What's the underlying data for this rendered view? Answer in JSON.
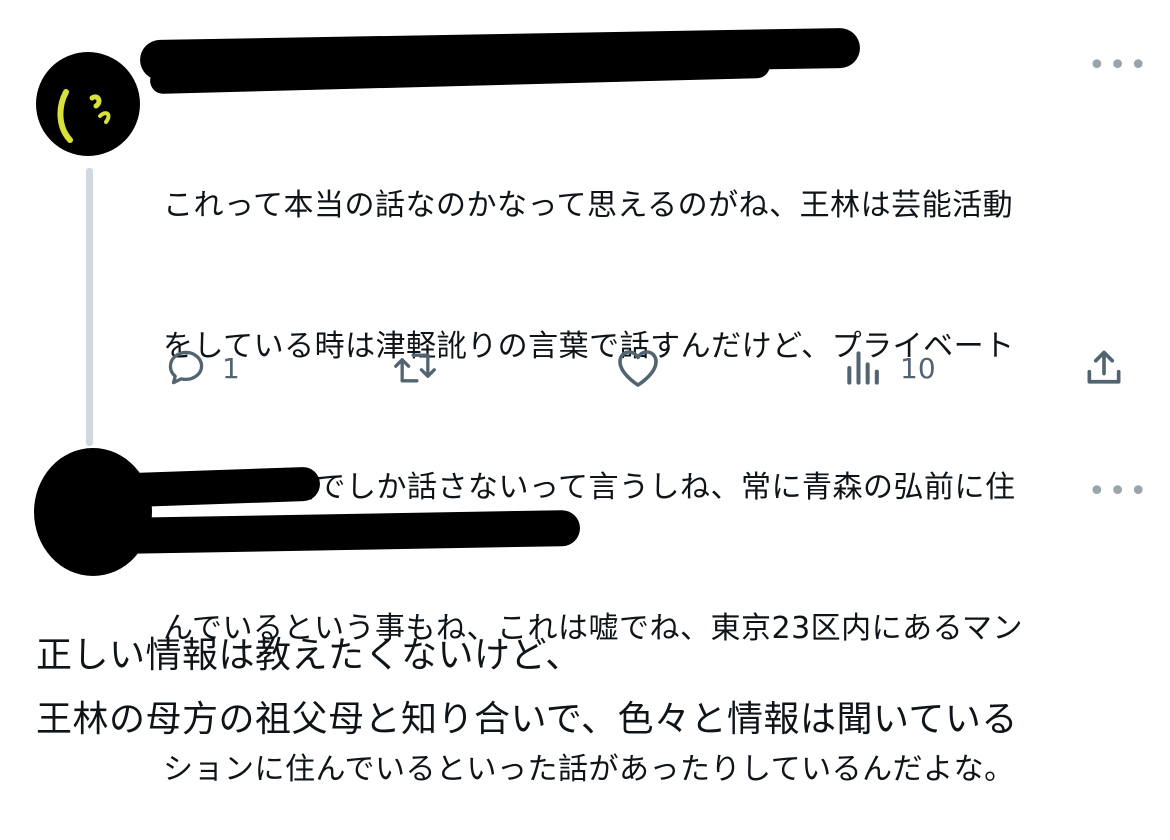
{
  "reply": {
    "text_lines": [
      "これって本当の話なのかなって思えるのがね、王林は芸能活動",
      "をしている時は津軽訛りの言葉で話すんだけど、プライベート",
      "では標準語でしか話さないって言うしね、常に青森の弘前に住",
      "んでいるという事もね、これは嘘でね、東京23区内にあるマン",
      "ションに住んでいるといった話があったりしているんだよな。"
    ],
    "actions": {
      "reply_count": "1",
      "retweet_count": "",
      "like_count": "",
      "views_count": "10"
    }
  },
  "post": {
    "text_lines": [
      "正しい情報は教えたくないけど、",
      "王林の母方の祖父母と知り合いで、色々と情報は聞いている"
    ]
  },
  "icons": {
    "reply": "reply-icon",
    "retweet": "retweet-icon",
    "like": "heart-icon",
    "views": "views-icon",
    "share": "share-icon",
    "more": "more-icon"
  },
  "colors": {
    "text": "#0f1419",
    "secondary": "#536471",
    "thread_line": "#cfd9de",
    "avatar_accent": "#d8e03a"
  }
}
